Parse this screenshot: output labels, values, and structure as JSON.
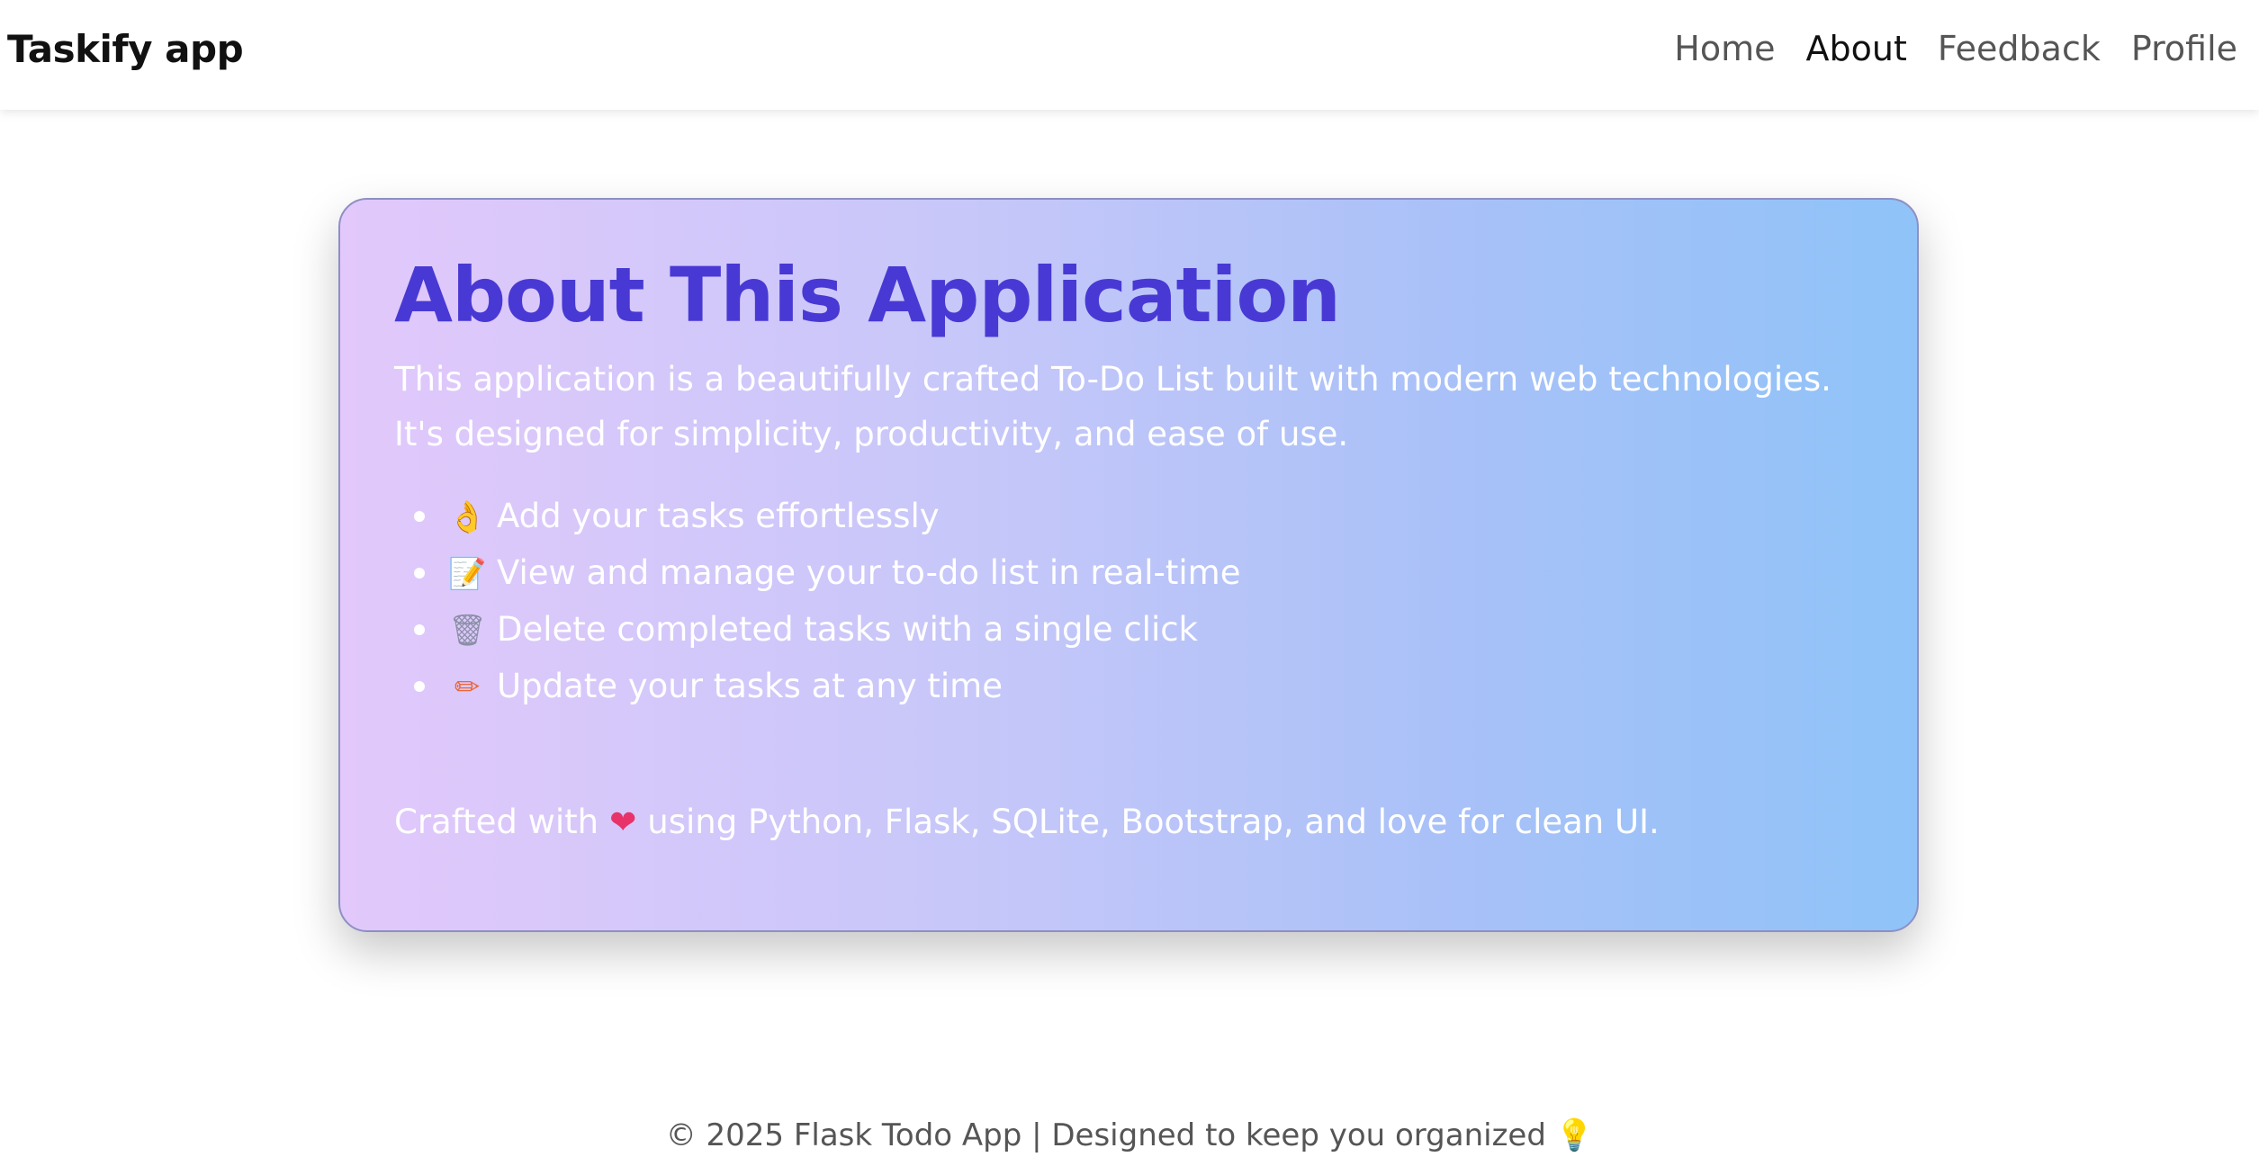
{
  "navbar": {
    "brand": "Taskify app",
    "links": [
      {
        "label": "Home",
        "active": false
      },
      {
        "label": "About",
        "active": true
      },
      {
        "label": "Feedback",
        "active": false
      },
      {
        "label": "Profile",
        "active": false
      }
    ]
  },
  "card": {
    "title": "About This Application",
    "description": "This application is a beautifully crafted To-Do List built with modern web technologies. It's designed for simplicity, productivity, and ease of use.",
    "features": [
      {
        "icon": "ok-hand-icon",
        "emoji": "👌",
        "text": "Add your tasks effortlessly"
      },
      {
        "icon": "memo-icon",
        "emoji": "📝",
        "text": "View and manage your to-do list in real-time"
      },
      {
        "icon": "wastebasket-icon",
        "emoji": "🗑",
        "text": "Delete completed tasks with a single click"
      },
      {
        "icon": "pencil-icon",
        "emoji": "✏",
        "text": "Update your tasks at any time"
      }
    ],
    "crafted_prefix": "Crafted with",
    "crafted_heart": "❤",
    "crafted_suffix": "using Python, Flask, SQLite, Bootstrap, and love for clean UI.",
    "gradient_colors": [
      "#e2c8fb",
      "#8fc3f8"
    ],
    "title_color": "#4839d4"
  },
  "footer": {
    "text": "© 2025 Flask Todo App | Designed to keep you organized",
    "bulb": "💡"
  }
}
